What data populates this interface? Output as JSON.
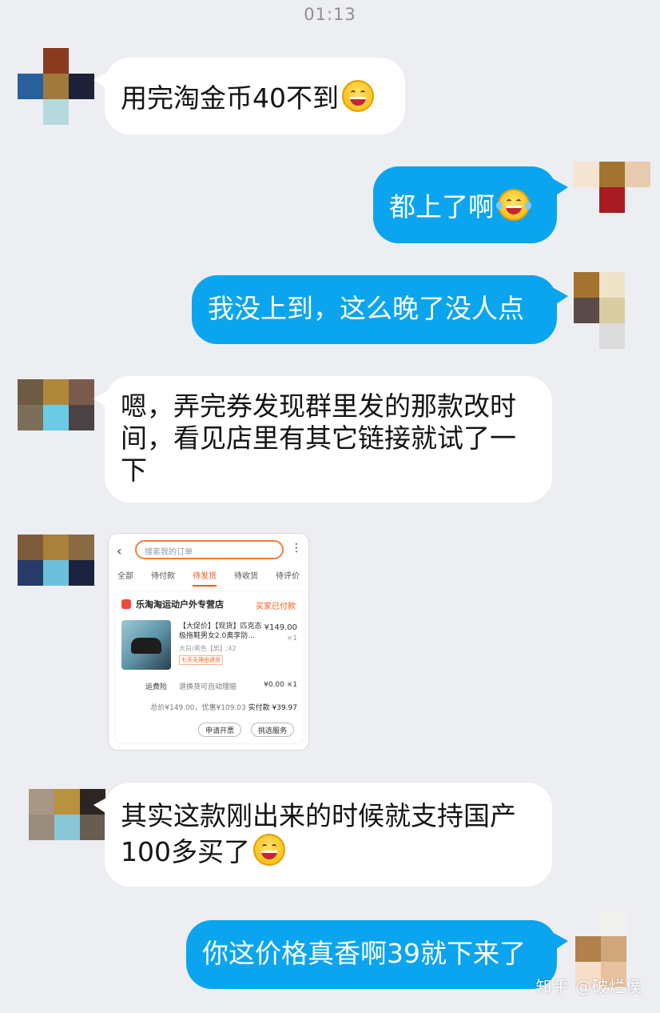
{
  "status": {
    "time": "01:13"
  },
  "messages": [
    {
      "side": "in",
      "text": "用完淘金币40不到",
      "emoji": "grin-emoji"
    },
    {
      "side": "out",
      "text": "都上了啊",
      "emoji": "laugh-cry-emoji"
    },
    {
      "side": "out",
      "text": "我没上到，这么晚了没人点"
    },
    {
      "side": "in",
      "text": "嗯，弄完券发现群里发的那款改时间，看见店里有其它链接就试了一下"
    },
    {
      "side": "in",
      "text": "其实这款刚出来的时候就支持国产100多买了",
      "emoji": "grin-emoji"
    },
    {
      "side": "out",
      "text": "你这价格真香啊39就下来了"
    }
  ],
  "shared_screenshot": {
    "search_placeholder": "搜索我的订单",
    "more_icon": "⋮",
    "back_icon": "‹",
    "tabs": [
      "全部",
      "待付款",
      "待发货",
      "待收货",
      "待评价"
    ],
    "active_tab": "待发货",
    "shop_name": "乐淘淘运动户外专营店",
    "order_status": "买家已付款",
    "product_title": "【大促价】【现货】匹克态极拖鞋男女2.0奥李防...",
    "product_sku": "大白/黑色【男】;42",
    "product_tag": "七天无理由退货",
    "product_price": "¥149.00",
    "product_qty": "×1",
    "insurance_label": "运费险",
    "insurance_desc": "退换货可自动理赔",
    "insurance_price": "¥0.00 ×1",
    "summary_text": "总价¥149.00，优惠¥109.03",
    "summary_paid_label": "实付款",
    "summary_paid_value": "¥39.97",
    "button_invoice": "申请开票",
    "button_service": "挑选服务"
  },
  "watermark": "知乎 @破烂侯",
  "colors": {
    "background": "#edeef2",
    "outgoing": "#0aa5ee",
    "incoming": "#ffffff"
  }
}
